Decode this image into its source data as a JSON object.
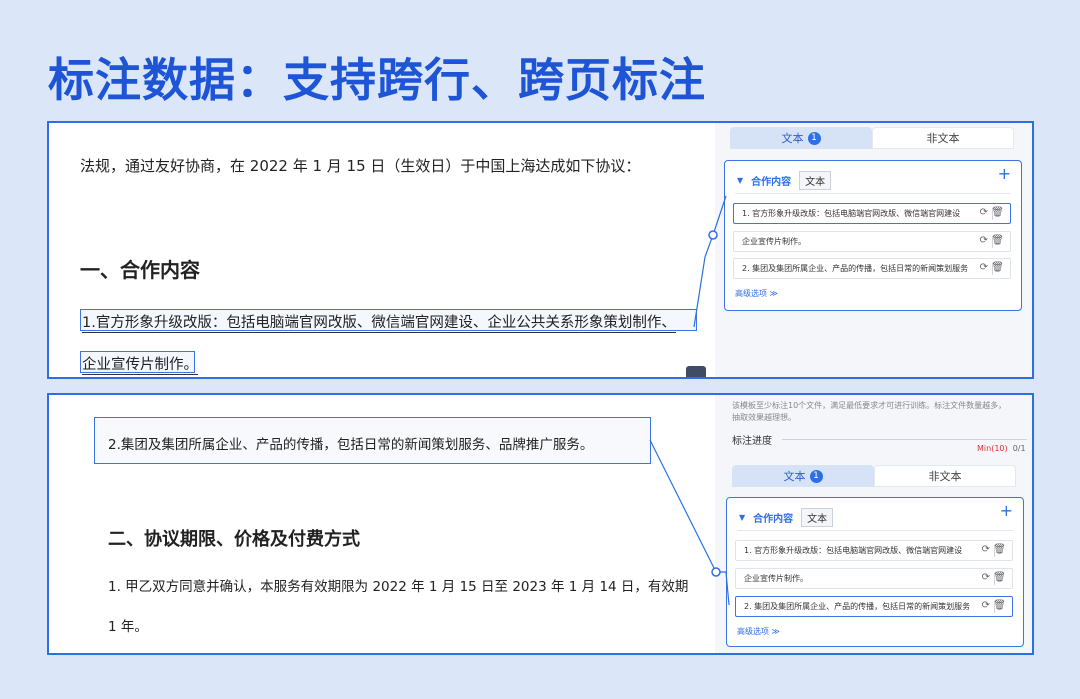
{
  "title": "标注数据：支持跨行、跨页标注",
  "panel1": {
    "doc": {
      "intro": "法规，通过友好协商，在 2022 年 1 月 15 日（生效日）于中国上海达成如下协议：",
      "heading": "一、合作内容",
      "line1": "1.官方形象升级改版：包括电脑端官网改版、微信端官网建设、企业公共关系形象策划制作、",
      "line2": "企业宣传片制作。"
    },
    "sidebar": {
      "tab_text": "文本",
      "tab_text_count": "1",
      "tab_nontext": "非文本",
      "card_title": "合作内容",
      "card_tag": "文本",
      "plus": "+",
      "rows": [
        "1. 官方形象升级改版：包括电脑端官网改版、微信端官网建设",
        "企业宣传片制作。",
        "2. 集团及集团所属企业、产品的传播，包括日常的新闻策划服务"
      ],
      "advanced": "高级选项",
      "advanced_caret": "≫"
    }
  },
  "panel2": {
    "doc": {
      "line": "2.集团及集团所属企业、产品的传播，包括日常的新闻策划服务、品牌推广服务。",
      "heading": "二、协议期限、价格及付费方式",
      "p1": "1. 甲乙双方同意并确认，本服务有效期限为 2022 年 1 月 15 日至 2023 年 1 月 14 日，有效期",
      "p2": "1 年。"
    },
    "sidebar": {
      "notice_line1": "该模板至少标注10个文件，满足最低要求才可进行训练。标注文件数量越多，",
      "notice_line2": "抽取效果越理想。",
      "progress_label": "标注进度",
      "progress_min": "Min(10)",
      "progress_count": "0/1",
      "tab_text": "文本",
      "tab_text_count": "1",
      "tab_nontext": "非文本",
      "card_title": "合作内容",
      "card_tag": "文本",
      "plus": "+",
      "rows": [
        "1. 官方形象升级改版：包括电脑端官网改版、微信端官网建设",
        "企业宣传片制作。",
        "2. 集团及集团所属企业、产品的传播，包括日常的新闻策划服务"
      ],
      "advanced": "高级选项",
      "advanced_caret": "≫"
    }
  }
}
